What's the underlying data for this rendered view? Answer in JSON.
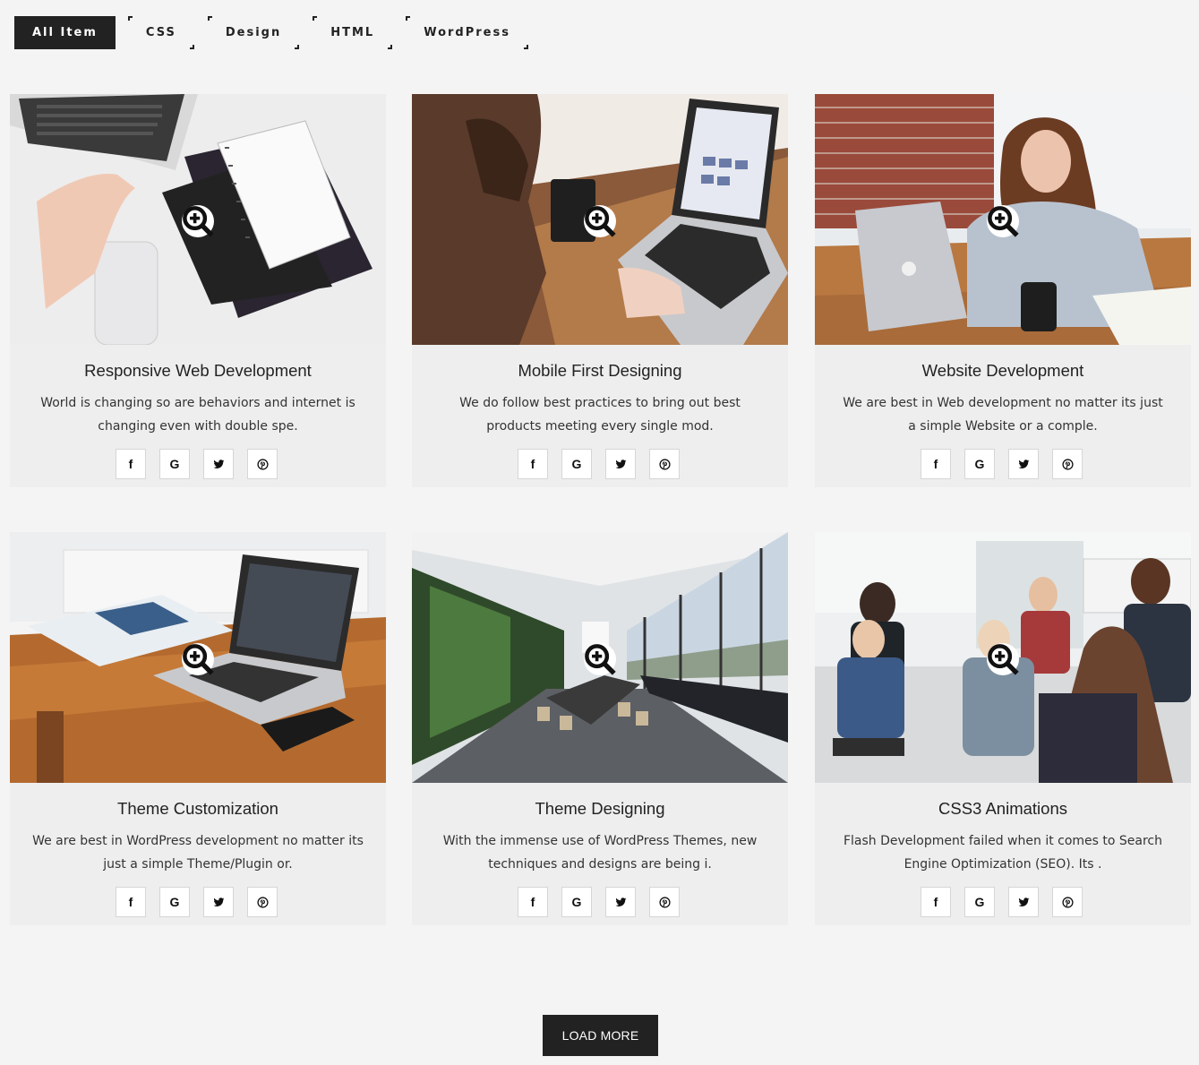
{
  "filters": [
    {
      "label": "All Item"
    },
    {
      "label": "CSS"
    },
    {
      "label": "Design"
    },
    {
      "label": "HTML"
    },
    {
      "label": "WordPress"
    }
  ],
  "cards": [
    {
      "title": "Responsive Web Development",
      "text": "World is changing so are behaviors and internet is changing even with double spe."
    },
    {
      "title": "Mobile First Designing",
      "text": "We do follow best practices to bring out best products meeting every single mod."
    },
    {
      "title": "Website Development",
      "text": "We are best in Web development no matter its just a simple Website or a comple."
    },
    {
      "title": "Theme Customization",
      "text": "We are best in WordPress development no matter its just a simple Theme/Plugin or."
    },
    {
      "title": "Theme Designing",
      "text": "With the immense use of WordPress Themes, new techniques and designs are being i."
    },
    {
      "title": "CSS3 Animations",
      "text": "Flash Development failed when it comes to Search Engine Optimization (SEO). Its ."
    }
  ],
  "social": {
    "facebook": "f",
    "google": "G"
  },
  "load_more": "LOAD MORE",
  "colors": {
    "dark": "#222222",
    "card_bg": "#eeeeee",
    "page_bg": "#f4f4f4"
  }
}
